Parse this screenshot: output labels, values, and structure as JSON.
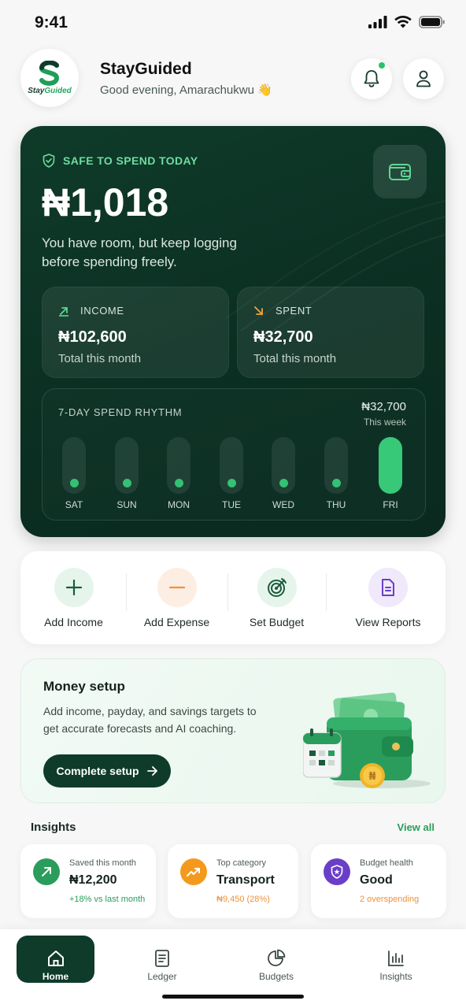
{
  "status_bar": {
    "time": "9:41"
  },
  "header": {
    "app_name": "StayGuided",
    "greeting": "Good evening, Amarachukwu 👋",
    "logo_text_a": "Stay",
    "logo_text_b": "Guided",
    "has_unread_notifications": true
  },
  "hero": {
    "label": "SAFE TO SPEND TODAY",
    "amount": "₦1,018",
    "note": "You have room, but keep logging before spending freely.",
    "income": {
      "label": "INCOME",
      "value": "₦102,600",
      "sub": "Total this month"
    },
    "spent": {
      "label": "SPENT",
      "value": "₦32,700",
      "sub": "Total this month"
    },
    "rhythm": {
      "title": "7-DAY SPEND RHYTHM",
      "total": "₦32,700",
      "total_sub": "This week",
      "days": [
        "SAT",
        "SUN",
        "MON",
        "TUE",
        "WED",
        "THU",
        "FRI"
      ],
      "active_day": "FRI"
    }
  },
  "actions": [
    {
      "label": "Add Income",
      "icon": "plus-icon",
      "color": "#e6f5ec"
    },
    {
      "label": "Add Expense",
      "icon": "minus-icon",
      "color": "#fdeee3"
    },
    {
      "label": "Set Budget",
      "icon": "target-icon",
      "color": "#e6f5ec"
    },
    {
      "label": "View Reports",
      "icon": "report-icon",
      "color": "#efe9fb"
    }
  ],
  "setup": {
    "title": "Money setup",
    "desc": "Add income, payday, and savings targets to get accurate forecasts and AI coaching.",
    "button": "Complete setup"
  },
  "insights": {
    "title": "Insights",
    "view_all": "View all",
    "cards": [
      {
        "label": "Saved this month",
        "value": "₦12,200",
        "sub": "+18% vs last month",
        "color": "#2a9d5c"
      },
      {
        "label": "Top category",
        "value": "Transport",
        "sub": "₦9,450 (28%)",
        "color": "#f39a1e"
      },
      {
        "label": "Budget health",
        "value": "Good",
        "sub": "2 overspending",
        "color": "#6a3fc8"
      }
    ]
  },
  "nav": [
    {
      "label": "Home",
      "icon": "home-icon",
      "active": true
    },
    {
      "label": "Ledger",
      "icon": "ledger-icon"
    },
    {
      "label": "Budgets",
      "icon": "pie-chart-icon"
    },
    {
      "label": "Insights",
      "icon": "bar-chart-icon"
    }
  ]
}
